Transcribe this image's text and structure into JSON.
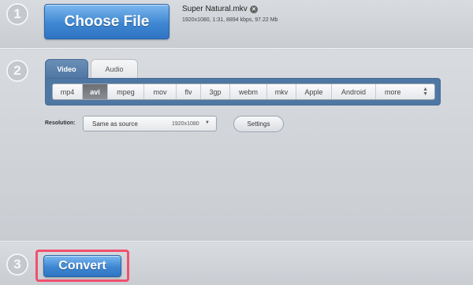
{
  "steps": [
    "1",
    "2",
    "3"
  ],
  "choose_file": {
    "label": "Choose File"
  },
  "file": {
    "name": "Super Natural.mkv",
    "remove_icon": "close-circle-icon",
    "meta": "1920x1080, 1:31, 8894 kbps, 97.22 Mb"
  },
  "tabs": [
    {
      "label": "Video",
      "active": true
    },
    {
      "label": "Audio",
      "active": false
    }
  ],
  "formats": [
    "mp4",
    "avi",
    "mpeg",
    "mov",
    "flv",
    "3gp",
    "webm",
    "mkv",
    "Apple",
    "Android",
    "more"
  ],
  "selected_format": "avi",
  "resolution": {
    "label": "Resolution:",
    "value": "Same as source",
    "dimensions": "1920x1080"
  },
  "settings_label": "Settings",
  "convert_label": "Convert",
  "colors": {
    "accent_blue": "#3f87d3",
    "tab_panel": "#4f77a3",
    "highlight": "#f0506e"
  }
}
